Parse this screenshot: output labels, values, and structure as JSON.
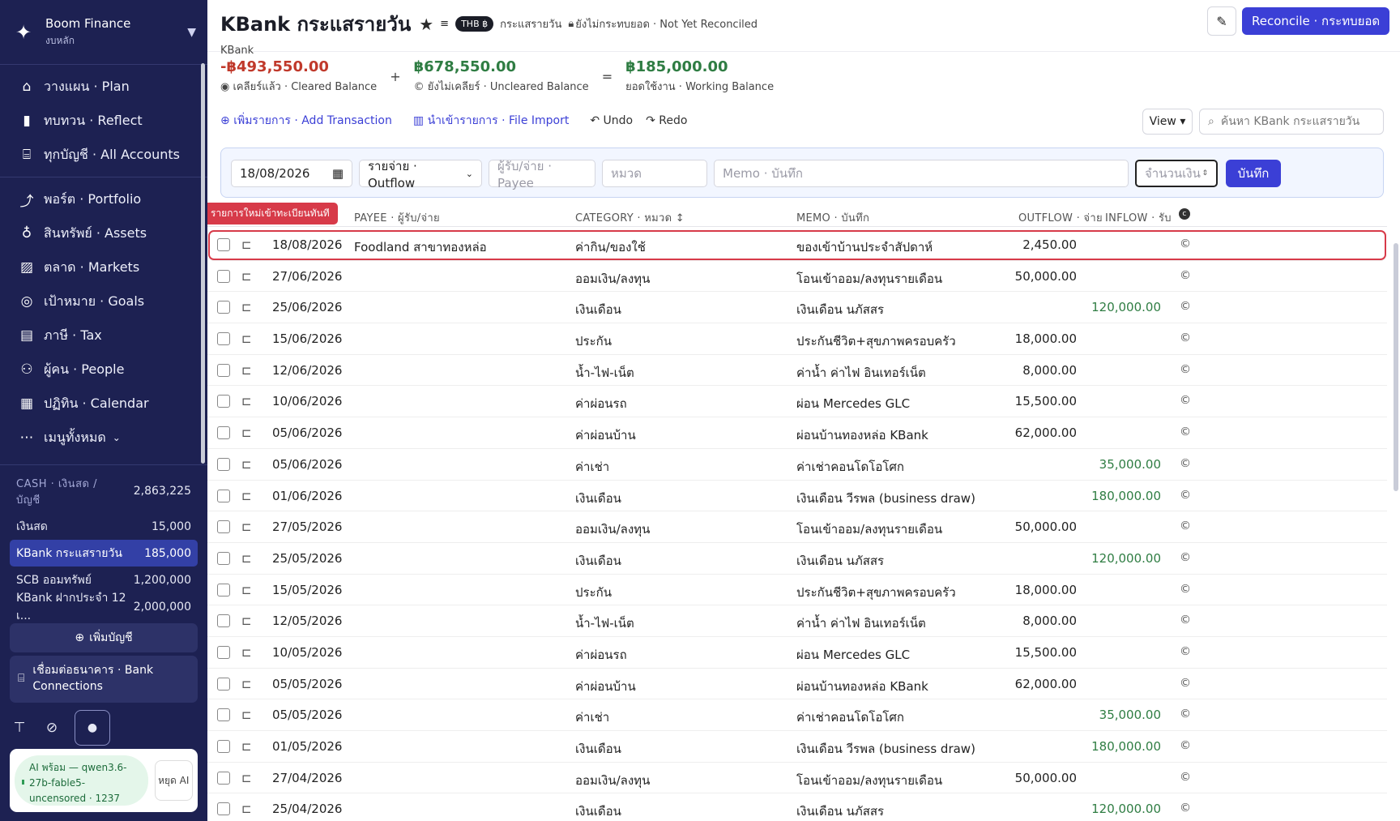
{
  "sidebar": {
    "brand_title": "Boom Finance",
    "brand_sub": "งบหลัก",
    "nav": [
      {
        "label": "วางแผน · Plan",
        "icon": "plan-icon"
      },
      {
        "label": "ทบทวน · Reflect",
        "icon": "reflect-icon"
      },
      {
        "label": "ทุกบัญชี · All Accounts",
        "icon": "bank-icon"
      },
      {
        "label": "พอร์ต · Portfolio",
        "icon": "chart-line-icon"
      },
      {
        "label": "สินทรัพย์ · Assets",
        "icon": "assets-icon"
      },
      {
        "label": "ตลาด · Markets",
        "icon": "markets-icon"
      },
      {
        "label": "เป้าหมาย · Goals",
        "icon": "goals-icon"
      },
      {
        "label": "ภาษี · Tax",
        "icon": "tax-icon"
      },
      {
        "label": "ผู้คน · People",
        "icon": "people-icon"
      },
      {
        "label": "ปฏิทิน · Calendar",
        "icon": "calendar-icon"
      },
      {
        "label": "เมนูทั้งหมด",
        "icon": "more-icon"
      }
    ],
    "cash_head": "CASH · เงินสด / บัญชี",
    "cash_total": "2,863,225",
    "accounts": [
      {
        "name": "เงินสด",
        "value": "15,000"
      },
      {
        "name": "KBank กระแสรายวัน",
        "value": "185,000"
      },
      {
        "name": "SCB ออมทรัพย์",
        "value": "1,200,000"
      },
      {
        "name": "KBank ฝากประจำ 12 เ...",
        "value": "2,000,000"
      }
    ],
    "add_account": "เพิ่มบัญชี",
    "bank_connections": "เชื่อมต่อธนาคาร · Bank Connections",
    "ai_status": "AI พร้อม — qwen3.6-27b-fable5-uncensored · 1237",
    "ai_stop": "หยุด AI"
  },
  "header": {
    "title": "KBank กระแสรายวัน",
    "currency": "THB ฿",
    "type": "กระแสรายวัน",
    "reconcile_status": "ยังไม่กระทบยอด · Not Yet Reconciled",
    "bank": "KBank",
    "reconcile_button": "Reconcile · กระทบยอด"
  },
  "balances": {
    "cleared": "-฿493,550.00",
    "cleared_label": "เคลียร์แล้ว · Cleared Balance",
    "uncleared": "฿678,550.00",
    "uncleared_label": "ยังไม่เคลียร์ · Uncleared Balance",
    "working": "฿185,000.00",
    "working_label": "ยอดใช้งาน · Working Balance"
  },
  "toolbar": {
    "add": "เพิ่มรายการ · Add Transaction",
    "import": "นำเข้ารายการ · File Import",
    "undo": "Undo",
    "redo": "Redo",
    "view": "View ▾",
    "search_placeholder": "ค้นหา KBank กระแสรายวัน"
  },
  "entry": {
    "date": "18/08/2026",
    "type": "รายจ่าย · Outflow",
    "payee_placeholder": "ผู้รับ/จ่าย · Payee",
    "category_placeholder": "หมวด",
    "memo_placeholder": "Memo · บันทึก",
    "amount_placeholder": "จำนวนเงิน",
    "save": "บันทึก"
  },
  "table": {
    "new_badge": "รายการใหม่เข้าทะเบียนทันที",
    "col_payee": "PAYEE · ผู้รับ/จ่าย",
    "col_category": "CATEGORY · หมวด ↕",
    "col_memo": "MEMO · บันทึก",
    "col_outflow": "OUTFLOW · จ่าย",
    "col_inflow": "INFLOW · รับ",
    "rows": [
      {
        "date": "18/08/2026",
        "payee": "Foodland สาขาทองหล่อ",
        "category": "ค่ากิน/ของใช้",
        "memo": "ของเข้าบ้านประจำสัปดาห์",
        "out": "2,450.00",
        "in": ""
      },
      {
        "date": "27/06/2026",
        "payee": "",
        "category": "ออมเงิน/ลงทุน",
        "memo": "โอนเข้าออม/ลงทุนรายเดือน",
        "out": "50,000.00",
        "in": ""
      },
      {
        "date": "25/06/2026",
        "payee": "",
        "category": "เงินเดือน",
        "memo": "เงินเดือน นภัสสร",
        "out": "",
        "in": "120,000.00"
      },
      {
        "date": "15/06/2026",
        "payee": "",
        "category": "ประกัน",
        "memo": "ประกันชีวิต+สุขภาพครอบครัว",
        "out": "18,000.00",
        "in": ""
      },
      {
        "date": "12/06/2026",
        "payee": "",
        "category": "น้ำ-ไฟ-เน็ต",
        "memo": "ค่าน้ำ ค่าไฟ อินเทอร์เน็ต",
        "out": "8,000.00",
        "in": ""
      },
      {
        "date": "10/06/2026",
        "payee": "",
        "category": "ค่าผ่อนรถ",
        "memo": "ผ่อน Mercedes GLC",
        "out": "15,500.00",
        "in": ""
      },
      {
        "date": "05/06/2026",
        "payee": "",
        "category": "ค่าผ่อนบ้าน",
        "memo": "ผ่อนบ้านทองหล่อ KBank",
        "out": "62,000.00",
        "in": ""
      },
      {
        "date": "05/06/2026",
        "payee": "",
        "category": "ค่าเช่า",
        "memo": "ค่าเช่าคอนโดโอโศก",
        "out": "",
        "in": "35,000.00"
      },
      {
        "date": "01/06/2026",
        "payee": "",
        "category": "เงินเดือน",
        "memo": "เงินเดือน วีรพล (business draw)",
        "out": "",
        "in": "180,000.00"
      },
      {
        "date": "27/05/2026",
        "payee": "",
        "category": "ออมเงิน/ลงทุน",
        "memo": "โอนเข้าออม/ลงทุนรายเดือน",
        "out": "50,000.00",
        "in": ""
      },
      {
        "date": "25/05/2026",
        "payee": "",
        "category": "เงินเดือน",
        "memo": "เงินเดือน นภัสสร",
        "out": "",
        "in": "120,000.00"
      },
      {
        "date": "15/05/2026",
        "payee": "",
        "category": "ประกัน",
        "memo": "ประกันชีวิต+สุขภาพครอบครัว",
        "out": "18,000.00",
        "in": ""
      },
      {
        "date": "12/05/2026",
        "payee": "",
        "category": "น้ำ-ไฟ-เน็ต",
        "memo": "ค่าน้ำ ค่าไฟ อินเทอร์เน็ต",
        "out": "8,000.00",
        "in": ""
      },
      {
        "date": "10/05/2026",
        "payee": "",
        "category": "ค่าผ่อนรถ",
        "memo": "ผ่อน Mercedes GLC",
        "out": "15,500.00",
        "in": ""
      },
      {
        "date": "05/05/2026",
        "payee": "",
        "category": "ค่าผ่อนบ้าน",
        "memo": "ผ่อนบ้านทองหล่อ KBank",
        "out": "62,000.00",
        "in": ""
      },
      {
        "date": "05/05/2026",
        "payee": "",
        "category": "ค่าเช่า",
        "memo": "ค่าเช่าคอนโดโอโศก",
        "out": "",
        "in": "35,000.00"
      },
      {
        "date": "01/05/2026",
        "payee": "",
        "category": "เงินเดือน",
        "memo": "เงินเดือน วีรพล (business draw)",
        "out": "",
        "in": "180,000.00"
      },
      {
        "date": "27/04/2026",
        "payee": "",
        "category": "ออมเงิน/ลงทุน",
        "memo": "โอนเข้าออม/ลงทุนรายเดือน",
        "out": "50,000.00",
        "in": ""
      },
      {
        "date": "25/04/2026",
        "payee": "",
        "category": "เงินเดือน",
        "memo": "เงินเดือน นภัสสร",
        "out": "",
        "in": "120,000.00"
      }
    ]
  },
  "colors": {
    "sidebar": "#1d2152",
    "accent": "#3b3fd6",
    "negative": "#c0392b",
    "positive": "#2f7d43",
    "highlight": "#d73a49"
  }
}
